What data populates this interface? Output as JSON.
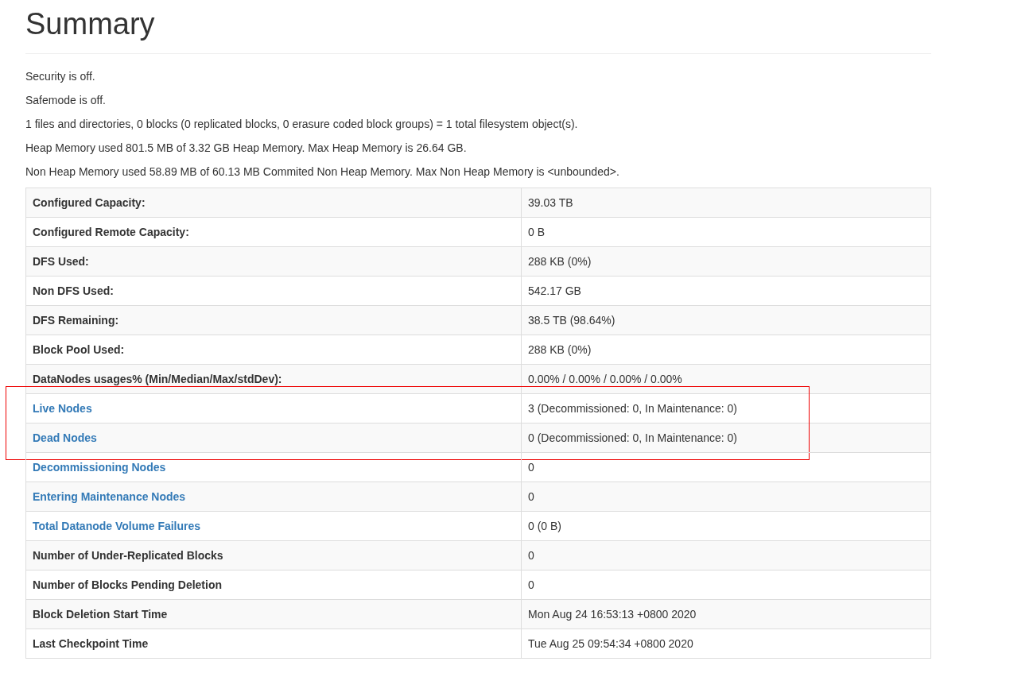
{
  "title": "Summary",
  "lines": [
    "Security is off.",
    "Safemode is off.",
    "1 files and directories, 0 blocks (0 replicated blocks, 0 erasure coded block groups) = 1 total filesystem object(s).",
    "Heap Memory used 801.5 MB of 3.32 GB Heap Memory. Max Heap Memory is 26.64 GB.",
    "Non Heap Memory used 58.89 MB of 60.13 MB Commited Non Heap Memory. Max Non Heap Memory is <unbounded>."
  ],
  "table": {
    "groups": [
      {
        "highlighted": false,
        "rows": [
          {
            "label": "Configured Capacity:",
            "value": "39.03 TB",
            "link": false
          },
          {
            "label": "Configured Remote Capacity:",
            "value": "0 B",
            "link": false
          },
          {
            "label": "DFS Used:",
            "value": "288 KB (0%)",
            "link": false
          },
          {
            "label": "Non DFS Used:",
            "value": "542.17 GB",
            "link": false
          },
          {
            "label": "DFS Remaining:",
            "value": "38.5 TB (98.64%)",
            "link": false
          },
          {
            "label": "Block Pool Used:",
            "value": "288 KB (0%)",
            "link": false
          },
          {
            "label": "DataNodes usages% (Min/Median/Max/stdDev):",
            "value": "0.00% / 0.00% / 0.00% / 0.00%",
            "link": false
          }
        ]
      },
      {
        "highlighted": true,
        "rows": [
          {
            "label": "Live Nodes",
            "value": "3 (Decommissioned: 0, In Maintenance: 0)",
            "link": true
          },
          {
            "label": "Dead Nodes",
            "value": "0 (Decommissioned: 0, In Maintenance: 0)",
            "link": true
          }
        ]
      },
      {
        "highlighted": false,
        "rows": [
          {
            "label": "Decommissioning Nodes",
            "value": "0",
            "link": true
          },
          {
            "label": "Entering Maintenance Nodes",
            "value": "0",
            "link": true
          },
          {
            "label": "Total Datanode Volume Failures",
            "value": "0 (0 B)",
            "link": true
          },
          {
            "label": "Number of Under-Replicated Blocks",
            "value": "0",
            "link": false
          },
          {
            "label": "Number of Blocks Pending Deletion",
            "value": "0",
            "link": false
          },
          {
            "label": "Block Deletion Start Time",
            "value": "Mon Aug 24 16:53:13 +0800 2020",
            "link": false
          },
          {
            "label": "Last Checkpoint Time",
            "value": "Tue Aug 25 09:54:34 +0800 2020",
            "link": false
          }
        ]
      }
    ]
  }
}
